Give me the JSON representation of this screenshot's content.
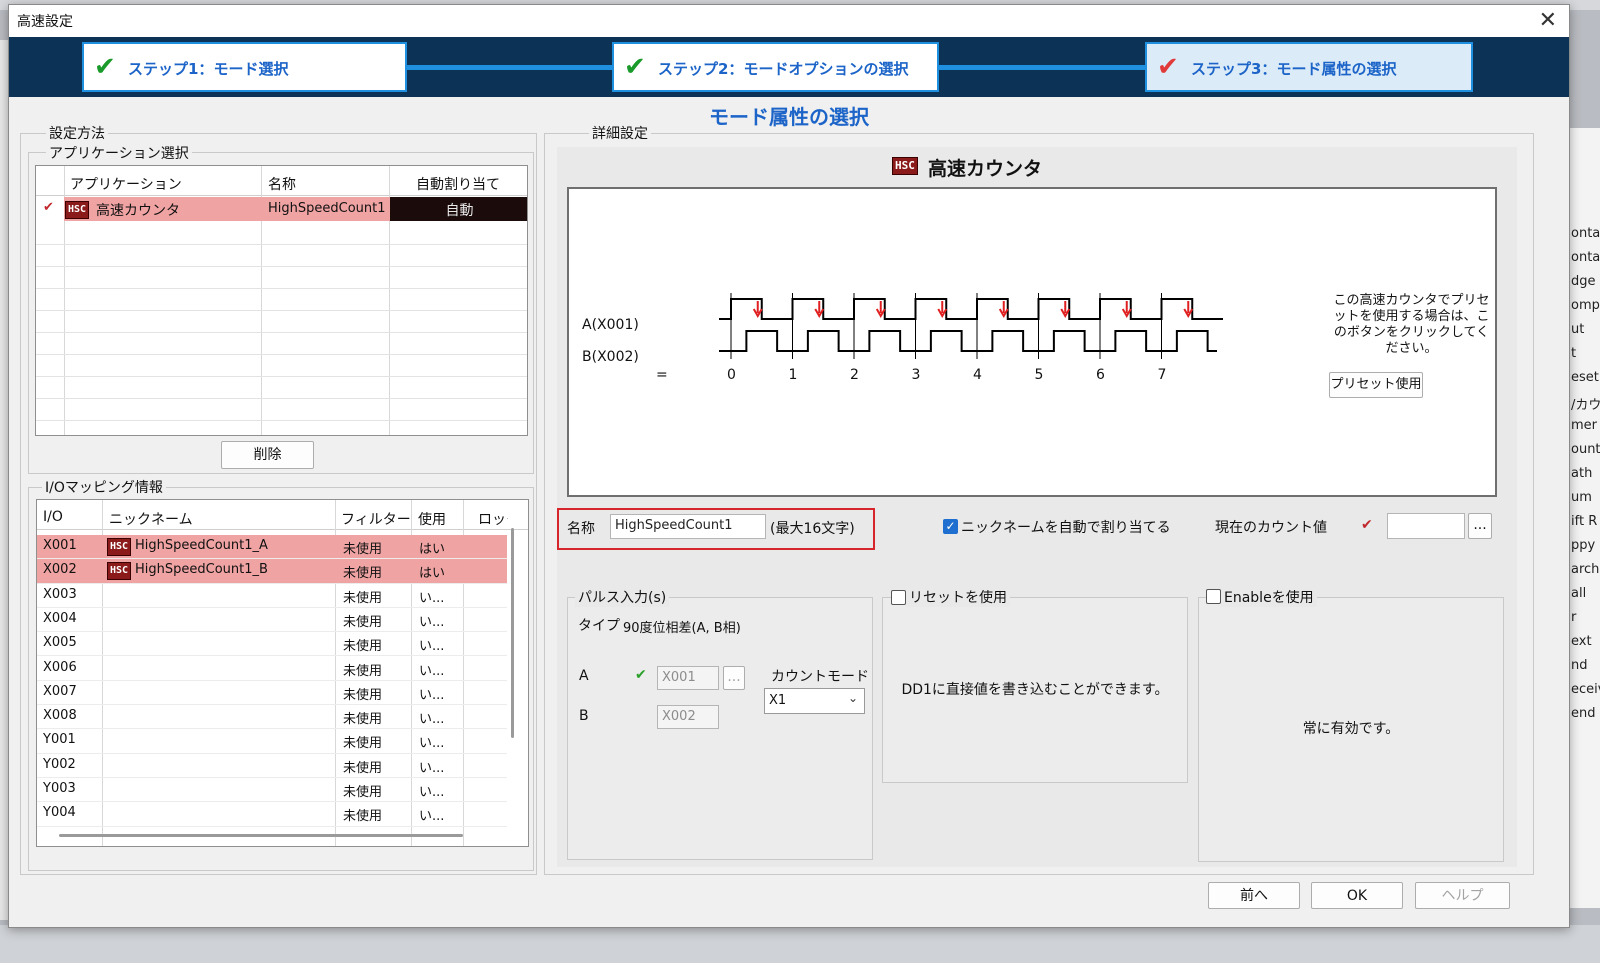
{
  "window": {
    "title": "高速設定",
    "close_glyph": "✕"
  },
  "steps": [
    {
      "label": "ステップ1：モード選択",
      "done": true
    },
    {
      "label": "ステップ2：モードオプションの選択",
      "done": true
    },
    {
      "label": "ステップ3：モード属性の選択",
      "done": true
    }
  ],
  "page_heading": "モード属性の選択",
  "left": {
    "method_label": "設定方法",
    "app_group_label": "アプリケーション選択",
    "app_table": {
      "headers": [
        "アプリケーション",
        "名称",
        "自動割り当て"
      ],
      "rows": [
        {
          "icon": "HSC",
          "application": "高速カウンタ",
          "name": "HighSpeedCount1",
          "auto": "自動"
        }
      ]
    },
    "delete_button": "削除",
    "io_group_label": "I/Oマッピング情報",
    "io_table": {
      "headers": [
        "I/O",
        "ニックネーム",
        "フィルター",
        "使用",
        "ロック"
      ],
      "rows": [
        {
          "io": "X001",
          "icon": "HSC",
          "nickname": "HighSpeedCount1_A",
          "filter": "未使用",
          "use": "はい",
          "hl": true
        },
        {
          "io": "X002",
          "icon": "HSC",
          "nickname": "HighSpeedCount1_B",
          "filter": "未使用",
          "use": "はい",
          "hl": true
        },
        {
          "io": "X003",
          "icon": "",
          "nickname": "",
          "filter": "未使用",
          "use": "い...",
          "hl": false
        },
        {
          "io": "X004",
          "icon": "",
          "nickname": "",
          "filter": "未使用",
          "use": "い...",
          "hl": false
        },
        {
          "io": "X005",
          "icon": "",
          "nickname": "",
          "filter": "未使用",
          "use": "い...",
          "hl": false
        },
        {
          "io": "X006",
          "icon": "",
          "nickname": "",
          "filter": "未使用",
          "use": "い...",
          "hl": false
        },
        {
          "io": "X007",
          "icon": "",
          "nickname": "",
          "filter": "未使用",
          "use": "い...",
          "hl": false
        },
        {
          "io": "X008",
          "icon": "",
          "nickname": "",
          "filter": "未使用",
          "use": "い...",
          "hl": false
        },
        {
          "io": "Y001",
          "icon": "",
          "nickname": "",
          "filter": "未使用",
          "use": "い...",
          "hl": false
        },
        {
          "io": "Y002",
          "icon": "",
          "nickname": "",
          "filter": "未使用",
          "use": "い...",
          "hl": false
        },
        {
          "io": "Y003",
          "icon": "",
          "nickname": "",
          "filter": "未使用",
          "use": "い...",
          "hl": false
        },
        {
          "io": "Y004",
          "icon": "",
          "nickname": "",
          "filter": "未使用",
          "use": "い...",
          "hl": false
        }
      ]
    }
  },
  "detail": {
    "group_label": "詳細設定",
    "icon": "HSC",
    "title": "高速カウンタ",
    "signal_a": "A(X001)",
    "signal_b": "B(X002)",
    "eq": "=",
    "ticks": [
      "0",
      "1",
      "2",
      "3",
      "4",
      "5",
      "6",
      "7"
    ],
    "preset_note": "この高速カウンタでプリセットを使用する場合は、このボタンをクリックしてください。",
    "preset_button": "プリセット使用",
    "name_label": "名称",
    "name_value": "HighSpeedCount1",
    "name_hint": "(最大16文字)",
    "auto_nick_label": "ニックネームを自動で割り当てる",
    "auto_nick_checked": true,
    "count_label": "現在のカウント値",
    "count_value": "",
    "ellipsis": "..."
  },
  "pulse": {
    "group_label": "パルス入力(s)",
    "type_label": "タイプ",
    "type_value": "90度位相差(A, B相)",
    "a_label": "A",
    "a_value": "X001",
    "b_label": "B",
    "b_value": "X002",
    "count_mode_label": "カウントモード",
    "count_mode_value": "X1"
  },
  "reset": {
    "label": "リセットを使用",
    "checked": false,
    "text": "DD1に直接値を書き込むことができます。"
  },
  "enable": {
    "label": "Enableを使用",
    "checked": false,
    "text": "常に有効です。"
  },
  "footer": {
    "prev": "前へ",
    "ok": "OK",
    "help": "ヘルプ"
  },
  "background_items": [
    "ontac",
    "ontac",
    "dge C",
    "omp",
    "ut",
    "t",
    "eset",
    "/カウ",
    "mer",
    "ount",
    "ath",
    "um",
    "ift R",
    "ppy",
    "arch",
    "all",
    "r",
    "ext",
    "nd",
    "eceiv",
    "end"
  ],
  "colors": {
    "accent": "#1f8fe0",
    "highlight_row": "#f0a3a3",
    "auto_cell": "#1b0b0b",
    "step_bar": "#0c3355",
    "pulse_arrow": "#e02020"
  }
}
